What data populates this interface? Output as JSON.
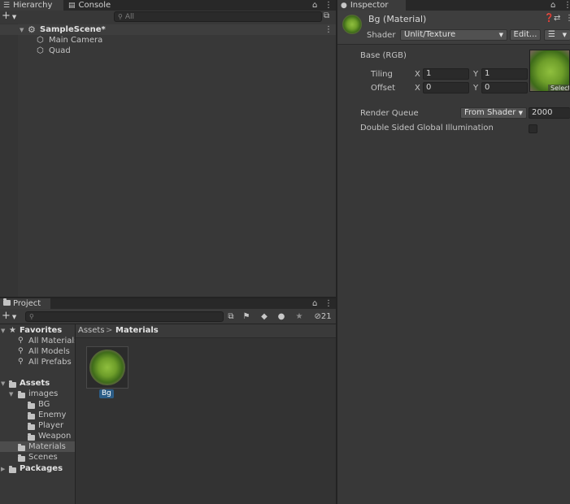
{
  "hierarchy": {
    "tab_label": "Hierarchy",
    "tab_icon": "hierarchy-icon",
    "console_tab_label": "Console",
    "add_label": "+",
    "search_placeholder": "All",
    "scene": {
      "name": "SampleScene*",
      "children": [
        "Main Camera",
        "Quad"
      ]
    }
  },
  "project": {
    "tab_label": "Project",
    "add_label": "+",
    "hidden_count": "21",
    "breadcrumb": {
      "root": "Assets",
      "separator": ">",
      "current": "Materials"
    },
    "favorites": {
      "label": "Favorites",
      "items": [
        "All Materials",
        "All Models",
        "All Prefabs"
      ]
    },
    "assets": {
      "label": "Assets",
      "images_label": "images",
      "image_children": [
        "BG",
        "Enemy",
        "Player",
        "Weapon"
      ],
      "materials_label": "Materials",
      "scenes_label": "Scenes"
    },
    "packages_label": "Packages",
    "grid_item": {
      "name": "Bg",
      "icon": "material-sphere-icon"
    }
  },
  "inspector": {
    "tab_label": "Inspector",
    "title": "Bg (Material)",
    "shader_label": "Shader",
    "shader_value": "Unlit/Texture",
    "edit_label": "Edit...",
    "base_label": "Base (RGB)",
    "tiling_label": "Tiling",
    "offset_label": "Offset",
    "x_label": "X",
    "y_label": "Y",
    "tiling_x": "1",
    "tiling_y": "1",
    "offset_x": "0",
    "offset_y": "0",
    "select_label": "Select",
    "render_queue_label": "Render Queue",
    "render_queue_mode": "From Shader",
    "render_queue_value": "2000",
    "double_sided_label": "Double Sided Global Illumination",
    "double_sided_checked": false
  },
  "colors": {
    "panel_bg": "#383838",
    "tab_bar": "#282828",
    "selection": "#4d4d4d",
    "label_highlight": "#2c5d87"
  }
}
